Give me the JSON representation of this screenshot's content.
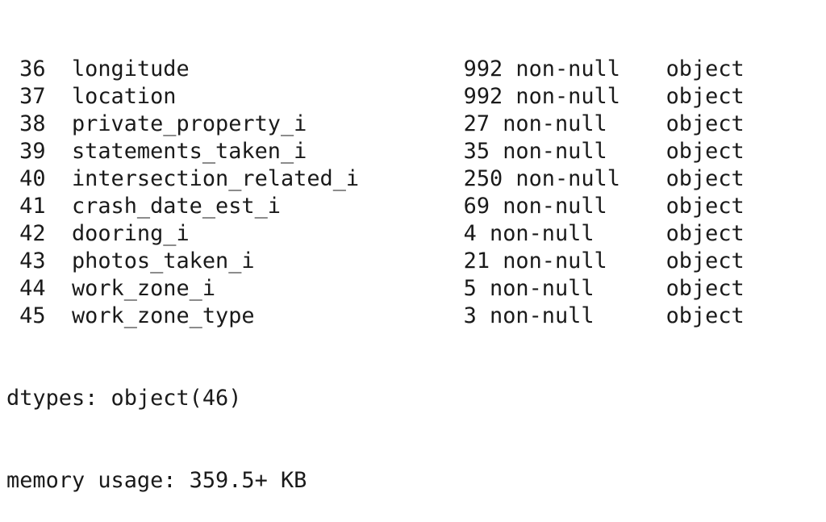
{
  "rows": [
    {
      "index": "36",
      "column": "longitude",
      "non_null": "992 non-null",
      "dtype": "object"
    },
    {
      "index": "37",
      "column": "location",
      "non_null": "992 non-null",
      "dtype": "object"
    },
    {
      "index": "38",
      "column": "private_property_i",
      "non_null": "27 non-null",
      "dtype": "object"
    },
    {
      "index": "39",
      "column": "statements_taken_i",
      "non_null": "35 non-null",
      "dtype": "object"
    },
    {
      "index": "40",
      "column": "intersection_related_i",
      "non_null": "250 non-null",
      "dtype": "object"
    },
    {
      "index": "41",
      "column": "crash_date_est_i",
      "non_null": "69 non-null",
      "dtype": "object"
    },
    {
      "index": "42",
      "column": "dooring_i",
      "non_null": "4 non-null",
      "dtype": "object"
    },
    {
      "index": "43",
      "column": "photos_taken_i",
      "non_null": "21 non-null",
      "dtype": "object"
    },
    {
      "index": "44",
      "column": "work_zone_i",
      "non_null": "5 non-null",
      "dtype": "object"
    },
    {
      "index": "45",
      "column": "work_zone_type",
      "non_null": "3 non-null",
      "dtype": "object"
    }
  ],
  "dtypes_line": "dtypes: object(46)",
  "memory_line": "memory usage: 359.5+ KB"
}
